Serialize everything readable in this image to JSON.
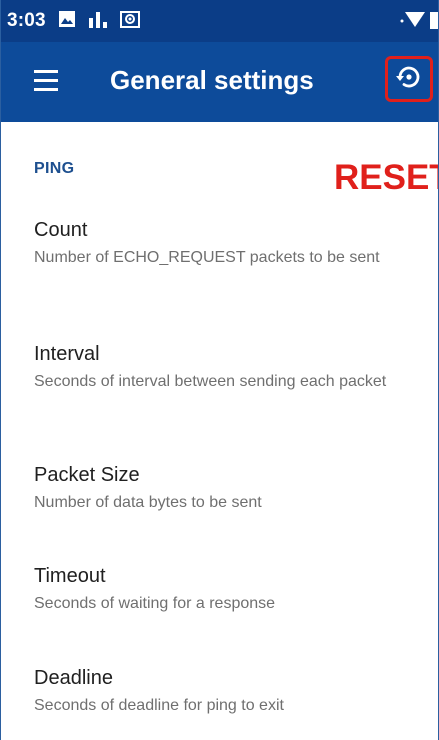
{
  "status_bar": {
    "time": "3:03",
    "icons_left": [
      "image-icon",
      "signal-bars-icon",
      "settings-gear-icon"
    ],
    "icons_right": [
      "wifi-icon",
      "battery-icon"
    ]
  },
  "app_bar": {
    "title": "General settings",
    "menu_icon": "hamburger-menu-icon",
    "reset_icon": "restore-icon"
  },
  "annotation": {
    "reset_label": "RESET",
    "color": "#e0201b"
  },
  "section": {
    "header": "PING"
  },
  "preferences": [
    {
      "title": "Count",
      "summary": "Number of ECHO_REQUEST packets to be sent"
    },
    {
      "title": "Interval",
      "summary": "Seconds of interval between sending each packet"
    },
    {
      "title": "Packet Size",
      "summary": "Number of data bytes to be sent"
    },
    {
      "title": "Timeout",
      "summary": "Seconds of waiting for a response"
    },
    {
      "title": "Deadline",
      "summary": "Seconds of deadline for ping to exit"
    }
  ],
  "colors": {
    "status_bar": "#0b3d87",
    "app_bar": "#0d4b9a",
    "section_header": "#1d4f8f",
    "title_text": "#202020",
    "summary_text": "#6f6f6f"
  }
}
